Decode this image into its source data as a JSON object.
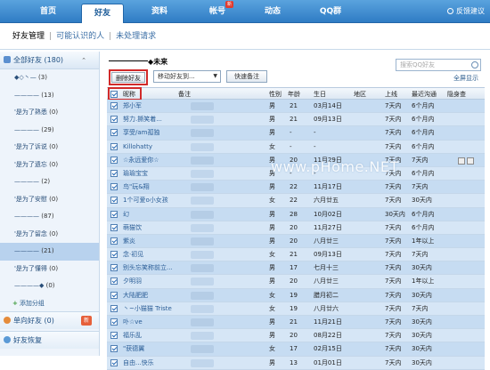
{
  "topnav": {
    "tabs": [
      {
        "label": "首页"
      },
      {
        "label": "好友"
      },
      {
        "label": "资料"
      },
      {
        "label": "帐号"
      },
      {
        "label": "动态"
      },
      {
        "label": "QQ群"
      }
    ],
    "badge": "新",
    "feedback": "反馈建议"
  },
  "subnav": {
    "current": "好友管理",
    "link1": "可能认识的人",
    "link2": "未处理请求"
  },
  "sidebar": {
    "all_label": "全部好友 (180)",
    "items": [
      {
        "label": "◆◇丶—",
        "count": "(3)"
      },
      {
        "label": "————",
        "count": "(13)"
      },
      {
        "label": "'是为了熟悉",
        "count": "(0)"
      },
      {
        "label": "————",
        "count": "(29)"
      },
      {
        "label": "'是为了诉说",
        "count": "(0)"
      },
      {
        "label": "'是为了遗忘",
        "count": "(0)"
      },
      {
        "label": "————",
        "count": "(2)"
      },
      {
        "label": "'是为了安慰",
        "count": "(0)"
      },
      {
        "label": "————",
        "count": "(87)"
      },
      {
        "label": "'是为了留念",
        "count": "(0)"
      },
      {
        "label": "————",
        "count": "(21)"
      },
      {
        "label": "'是为了懂得",
        "count": "(0)"
      },
      {
        "label": "————◆",
        "count": "(0)"
      }
    ],
    "add_group": "添加分组",
    "one_way": "单向好友 (0)",
    "new_tag": "新",
    "restore": "好友恢复"
  },
  "main": {
    "title": "◆未来",
    "search_placeholder": "搜索QQ好友",
    "fullscreen": "全屏显示",
    "delete_btn": "删除好友",
    "move_select": "移动好友到...",
    "quick_note": "快速备注",
    "headers": {
      "name": "昵称",
      "note": "备注",
      "gender": "性别",
      "age": "年龄",
      "birthday": "生日",
      "region": "地区",
      "online": "上线",
      "recent": "最近沟通",
      "hidden": "隐身查"
    },
    "rows": [
      {
        "nick": "郑小军",
        "gender": "男",
        "age": "21",
        "birthday": "03月14日",
        "online": "7天内",
        "recent": "6个月内"
      },
      {
        "nick": "努力.撕笑着...",
        "gender": "男",
        "age": "21",
        "birthday": "09月13日",
        "online": "7天内",
        "recent": "6个月内"
      },
      {
        "nick": "享受/am孤独",
        "gender": "男",
        "age": "-",
        "birthday": "-",
        "online": "7天内",
        "recent": "6个月内"
      },
      {
        "nick": "Killohatty",
        "gender": "女",
        "age": "-",
        "birthday": "-",
        "online": "7天内",
        "recent": "6个月内"
      },
      {
        "nick": "☆永远爱你☆",
        "gender": "男",
        "age": "20",
        "birthday": "11月29日",
        "online": "7天内",
        "recent": "7天内"
      },
      {
        "nick": "瑜瑜宝宝",
        "gender": "男",
        "age": "-",
        "birthday": "-",
        "online": "7天内",
        "recent": "6个月内"
      },
      {
        "nick": "鸟\"玩&翔",
        "gender": "男",
        "age": "22",
        "birthday": "11月17日",
        "online": "7天内",
        "recent": "7天内"
      },
      {
        "nick": "1个可爱o小女孩",
        "gender": "女",
        "age": "22",
        "birthday": "六月廿五",
        "online": "7天内",
        "recent": "30天内"
      },
      {
        "nick": "幻",
        "gender": "男",
        "age": "28",
        "birthday": "10月02日",
        "online": "30天内",
        "recent": "6个月内"
      },
      {
        "nick": "萌猫饮",
        "gender": "男",
        "age": "20",
        "birthday": "11月27日",
        "online": "7天内",
        "recent": "6个月内"
      },
      {
        "nick": "紫炎",
        "gender": "男",
        "age": "20",
        "birthday": "八月廿三",
        "online": "7天内",
        "recent": "1年以上"
      },
      {
        "nick": "念·初见",
        "gender": "女",
        "age": "21",
        "birthday": "09月13日",
        "online": "7天内",
        "recent": "7天内"
      },
      {
        "nick": "别头忘笑称前立...",
        "gender": "男",
        "age": "17",
        "birthday": "七月十三",
        "online": "7天内",
        "recent": "30天内"
      },
      {
        "nick": "夕明羽",
        "gender": "男",
        "age": "20",
        "birthday": "八月廿三",
        "online": "7天内",
        "recent": "1年以上"
      },
      {
        "nick": "大陆肥肥",
        "gender": "女",
        "age": "19",
        "birthday": "腊月初二",
        "online": "7天内",
        "recent": "30天内"
      },
      {
        "nick": "丶~小猫猫 Triste",
        "gender": "女",
        "age": "19",
        "birthday": "八月廿六",
        "online": "7天内",
        "recent": "7天内"
      },
      {
        "nick": "卟☆ve",
        "gender": "男",
        "age": "21",
        "birthday": "11月21日",
        "online": "7天内",
        "recent": "30天内"
      },
      {
        "nick": "福乐乱",
        "gender": "男",
        "age": "20",
        "birthday": "08月22日",
        "online": "7天内",
        "recent": "30天内"
      },
      {
        "nick": "\"获德翼",
        "gender": "女",
        "age": "17",
        "birthday": "02月15日",
        "online": "7天内",
        "recent": "30天内"
      },
      {
        "nick": "自由...快乐",
        "gender": "男",
        "age": "13",
        "birthday": "01月01日",
        "online": "7天内",
        "recent": "30天内"
      }
    ],
    "watermark": "www.pHome.NET"
  },
  "colors": {
    "nav_blue": "#2f7cc4",
    "highlight_red": "#d12a2a",
    "row_blue": "#c6dcf2"
  }
}
